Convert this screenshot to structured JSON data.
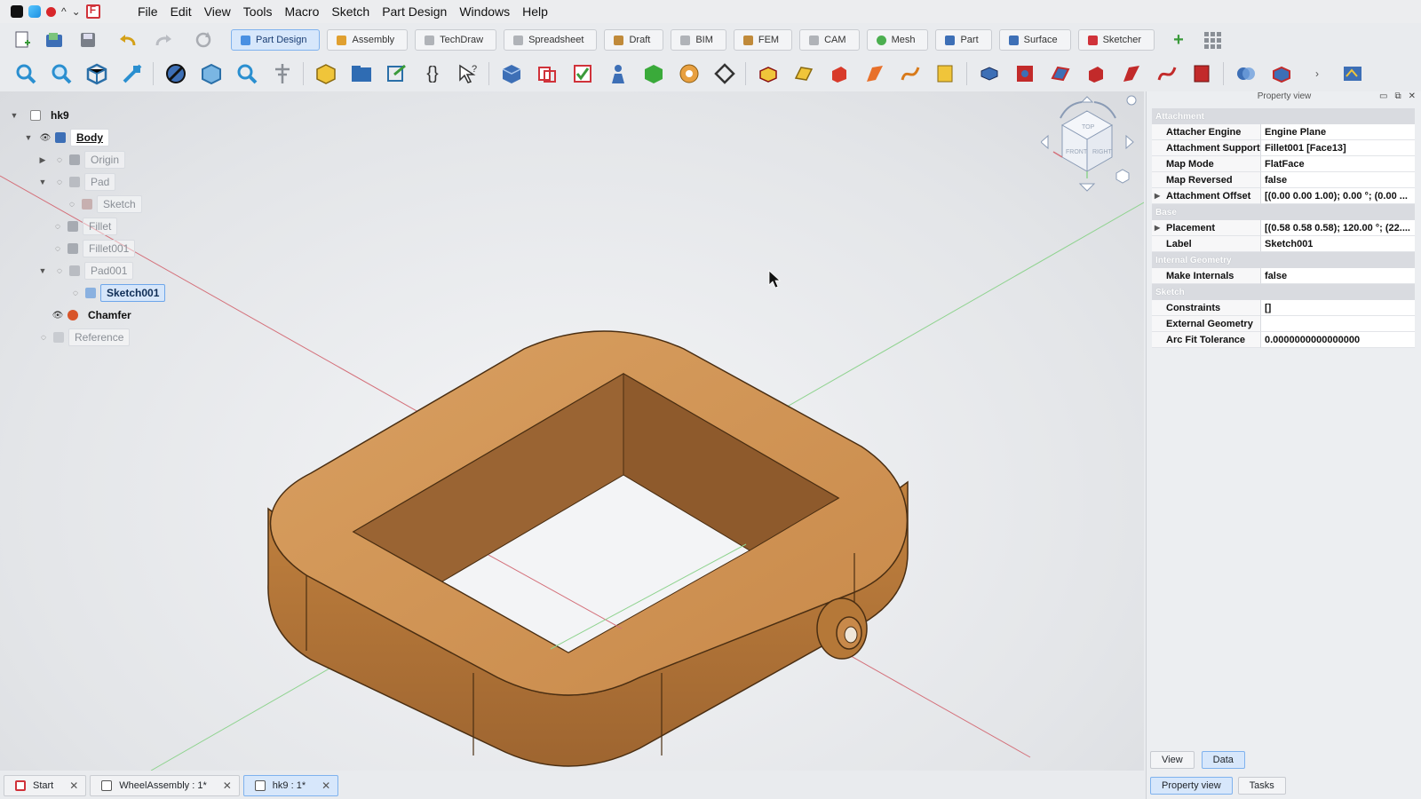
{
  "menubar": {
    "items": [
      "File",
      "Edit",
      "View",
      "Tools",
      "Macro",
      "Sketch",
      "Part Design",
      "Windows",
      "Help"
    ]
  },
  "workbenches": [
    {
      "label": "Part Design",
      "active": true,
      "color": "#4a90e2"
    },
    {
      "label": "Assembly",
      "active": false,
      "color": "#e0a030"
    },
    {
      "label": "TechDraw",
      "active": false,
      "color": "#8a8f96"
    },
    {
      "label": "Spreadsheet",
      "active": false,
      "color": "#8a8f96"
    },
    {
      "label": "Draft",
      "active": false,
      "color": "#c08a3a"
    },
    {
      "label": "BIM",
      "active": false,
      "color": "#8a8f96"
    },
    {
      "label": "FEM",
      "active": false,
      "color": "#c08a3a"
    },
    {
      "label": "CAM",
      "active": false,
      "color": "#8a8f96"
    },
    {
      "label": "Mesh",
      "active": false,
      "color": "#4caf50"
    },
    {
      "label": "Part",
      "active": false,
      "color": "#3d6fb6"
    },
    {
      "label": "Surface",
      "active": false,
      "color": "#3d6fb6"
    },
    {
      "label": "Sketcher",
      "active": false,
      "color": "#d0323a"
    }
  ],
  "tree": {
    "items": [
      {
        "label": "hk9",
        "state": "bold"
      },
      {
        "label": "Body",
        "state": "bold-under"
      },
      {
        "label": "Origin",
        "state": "dim"
      },
      {
        "label": "Pad",
        "state": "dim"
      },
      {
        "label": "Sketch",
        "state": "dim"
      },
      {
        "label": "Fillet",
        "state": "dim"
      },
      {
        "label": "Fillet001",
        "state": "dim"
      },
      {
        "label": "Pad001",
        "state": "dim"
      },
      {
        "label": "Sketch001",
        "state": "selected"
      },
      {
        "label": "Chamfer",
        "state": "bold"
      },
      {
        "label": "Reference",
        "state": "dim"
      }
    ]
  },
  "navcube": {
    "faces": [
      "TOP",
      "FRONT",
      "RIGHT"
    ]
  },
  "property_view": {
    "title": "Property view",
    "groups": [
      {
        "name": "Attachment",
        "rows": [
          {
            "name": "Attacher Engine",
            "value": "Engine Plane",
            "expandable": false
          },
          {
            "name": "Attachment Support",
            "value": "Fillet001 [Face13]",
            "expandable": false
          },
          {
            "name": "Map Mode",
            "value": "FlatFace",
            "expandable": false
          },
          {
            "name": "Map Reversed",
            "value": "false",
            "expandable": false
          },
          {
            "name": "Attachment Offset",
            "value": "[(0.00 0.00 1.00); 0.00 °; (0.00 ...",
            "expandable": true
          }
        ]
      },
      {
        "name": "Base",
        "rows": [
          {
            "name": "Placement",
            "value": "[(0.58 0.58 0.58); 120.00 °; (22....",
            "expandable": true
          },
          {
            "name": "Label",
            "value": "Sketch001",
            "expandable": false
          }
        ]
      },
      {
        "name": "Internal Geometry",
        "rows": [
          {
            "name": "Make Internals",
            "value": "false",
            "expandable": false
          }
        ]
      },
      {
        "name": "Sketch",
        "rows": [
          {
            "name": "Constraints",
            "value": "[]",
            "expandable": false
          },
          {
            "name": "External Geometry",
            "value": "",
            "expandable": false
          },
          {
            "name": "Arc Fit Tolerance",
            "value": "0.0000000000000000",
            "expandable": false
          }
        ]
      }
    ],
    "tabs": [
      "View",
      "Data"
    ],
    "active_tab": "Data",
    "bottom_tabs": [
      "Property view",
      "Tasks"
    ],
    "active_bottom_tab": "Property view"
  },
  "document_tabs": [
    {
      "label": "Start",
      "active": false
    },
    {
      "label": "WheelAssembly : 1*",
      "active": false
    },
    {
      "label": "hk9 : 1*",
      "active": true
    }
  ],
  "colors": {
    "part_fill": "#c8894a",
    "part_dark": "#8a5a2e",
    "part_inner": "#a06a38",
    "accent": "#4a90e2"
  }
}
